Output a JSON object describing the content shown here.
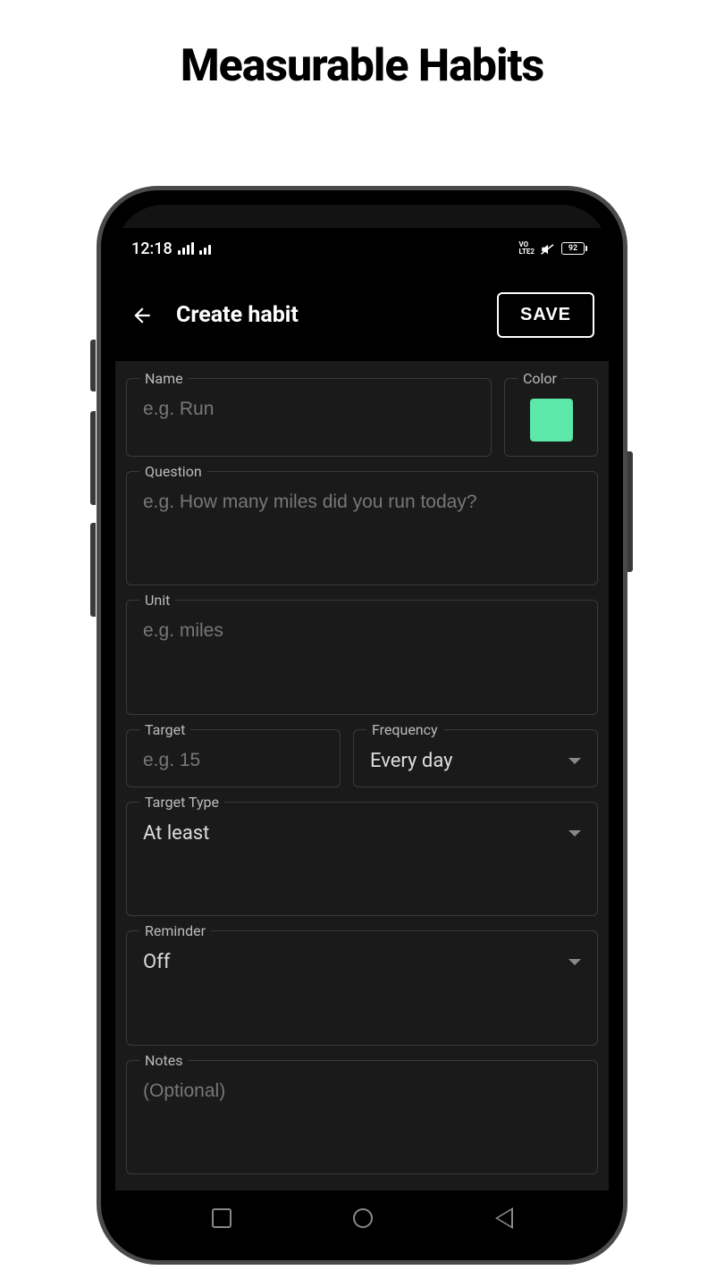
{
  "page": {
    "title": "Measurable Habits"
  },
  "status_bar": {
    "time": "12:18",
    "lte_line1": "VO",
    "lte_line2": "LTE2",
    "battery": "92"
  },
  "header": {
    "title": "Create habit",
    "save_label": "SAVE"
  },
  "form": {
    "name": {
      "label": "Name",
      "placeholder": "e.g. Run",
      "value": ""
    },
    "color": {
      "label": "Color",
      "value": "#5be8a8"
    },
    "question": {
      "label": "Question",
      "placeholder": "e.g. How many miles did you run today?",
      "value": ""
    },
    "unit": {
      "label": "Unit",
      "placeholder": "e.g. miles",
      "value": ""
    },
    "target": {
      "label": "Target",
      "placeholder": "e.g. 15",
      "value": ""
    },
    "frequency": {
      "label": "Frequency",
      "value": "Every day"
    },
    "target_type": {
      "label": "Target Type",
      "value": "At least"
    },
    "reminder": {
      "label": "Reminder",
      "value": "Off"
    },
    "notes": {
      "label": "Notes",
      "placeholder": "(Optional)",
      "value": ""
    }
  }
}
